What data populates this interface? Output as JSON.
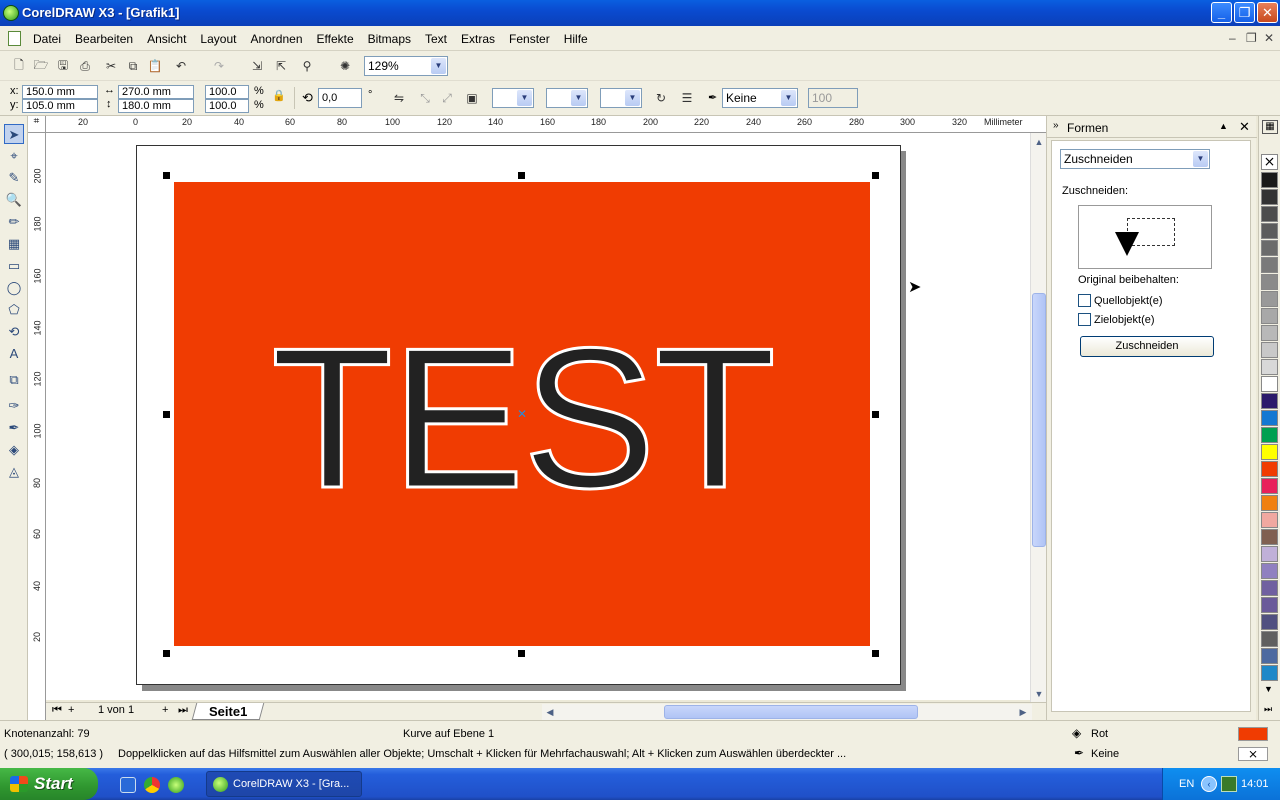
{
  "window": {
    "title": "CorelDRAW X3 - [Grafik1]",
    "min": "_",
    "max": "❐",
    "close": "✕"
  },
  "menu": {
    "items": [
      "Datei",
      "Bearbeiten",
      "Ansicht",
      "Layout",
      "Anordnen",
      "Effekte",
      "Bitmaps",
      "Text",
      "Extras",
      "Fenster",
      "Hilfe"
    ]
  },
  "toolbar": {
    "zoom": "129%"
  },
  "propertybar": {
    "x_label": "x:",
    "y_label": "y:",
    "x": "150.0 mm",
    "y": "105.0 mm",
    "width": "270.0 mm",
    "height": "180.0 mm",
    "scale_x": "100.0",
    "scale_y": "100.0",
    "percent": "%",
    "rotation": "0,0",
    "degree": "°",
    "outline": "Keine",
    "transparency": "100"
  },
  "ruler": {
    "unit": "Millimeter",
    "top_ticks": [
      "20",
      "0",
      "20",
      "40",
      "60",
      "80",
      "100",
      "120",
      "140",
      "160",
      "180",
      "200",
      "220",
      "240",
      "260",
      "280",
      "300",
      "320"
    ],
    "left_ticks": [
      "200",
      "180",
      "160",
      "140",
      "120",
      "100",
      "80",
      "60",
      "40",
      "20"
    ]
  },
  "canvas": {
    "text": "TEST",
    "rect_color": "#f03c02"
  },
  "pagenav": {
    "count": "1 von 1",
    "tab": "Seite1"
  },
  "docker": {
    "title": "Formen",
    "mode": "Zuschneiden",
    "section_label": "Zuschneiden:",
    "keep_label": "Original beibehalten:",
    "source": "Quellobjekt(e)",
    "target": "Zielobjekt(e)",
    "apply": "Zuschneiden"
  },
  "palette": {
    "colors": [
      "#1a1a1a",
      "#333333",
      "#4d4d4d",
      "#5c5c5c",
      "#6b6b6b",
      "#7a7a7a",
      "#8a8a8a",
      "#999999",
      "#a8a8a8",
      "#b8b8b8",
      "#c8c8c8",
      "#d8d8d8",
      "#ffffff",
      "#2b1a6b",
      "#1478d2",
      "#00a050",
      "#ffff00",
      "#f03c02",
      "#e8205a",
      "#f08010",
      "#f0a8a0",
      "#806050",
      "#c0b0d8",
      "#9080c0",
      "#7060a0",
      "#6a5a9a",
      "#505080",
      "#606060",
      "#4d6aa0",
      "#1e88c8"
    ]
  },
  "status": {
    "nodes": "Knotenanzahl: 79",
    "object": "Kurve auf Ebene 1",
    "coords": "( 300,015; 158,613 )",
    "hint": "Doppelklicken auf das Hilfsmittel zum Auswählen aller Objekte; Umschalt + Klicken für Mehrfachauswahl; Alt + Klicken zum Auswählen überdeckter ...",
    "fill_name": "Rot",
    "outline_name": "Keine",
    "fill_color": "#f03c02"
  },
  "taskbar": {
    "start": "Start",
    "task": "CorelDRAW X3 - [Gra...",
    "lang": "EN",
    "time": "14:01"
  }
}
